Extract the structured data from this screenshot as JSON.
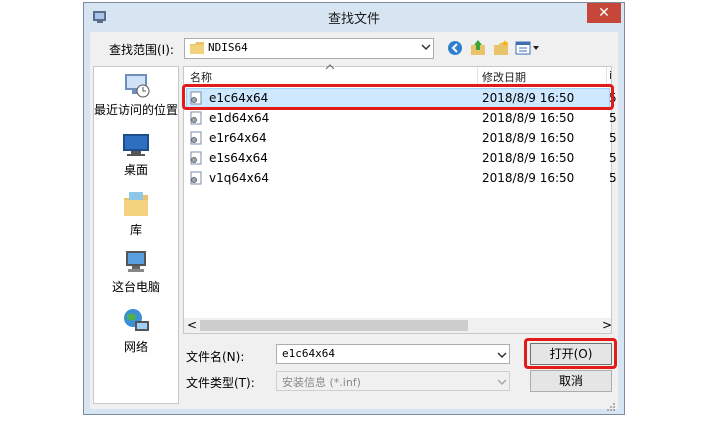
{
  "window": {
    "title": "查找文件",
    "close_glyph": "✕"
  },
  "lookin": {
    "label": "查找范围(I):",
    "value": "NDIS64"
  },
  "toolbar": {
    "icons": [
      "back-icon",
      "up-folder-icon",
      "new-folder-icon",
      "view-menu-icon"
    ]
  },
  "places": [
    {
      "label": "最近访问的位置",
      "icon": "recent-places-icon"
    },
    {
      "label": "桌面",
      "icon": "desktop-icon"
    },
    {
      "label": "库",
      "icon": "libraries-icon"
    },
    {
      "label": "这台电脑",
      "icon": "computer-icon"
    },
    {
      "label": "网络",
      "icon": "network-icon"
    }
  ],
  "columns": {
    "name": "名称",
    "date": "修改日期",
    "cut": "i"
  },
  "files": [
    {
      "name": "e1c64x64",
      "date": "2018/8/9 16:50",
      "cut": "5",
      "selected": true
    },
    {
      "name": "e1d64x64",
      "date": "2018/8/9 16:50",
      "cut": "5"
    },
    {
      "name": "e1r64x64",
      "date": "2018/8/9 16:50",
      "cut": "5"
    },
    {
      "name": "e1s64x64",
      "date": "2018/8/9 16:50",
      "cut": "5"
    },
    {
      "name": "v1q64x64",
      "date": "2018/8/9 16:50",
      "cut": "5"
    }
  ],
  "scroll": {
    "left": "<",
    "right": ">"
  },
  "filename": {
    "label": "文件名(N):",
    "value": "e1c64x64"
  },
  "filetype": {
    "label": "文件类型(T):",
    "value": "安装信息 (*.inf)"
  },
  "buttons": {
    "open": "打开(O)",
    "cancel": "取消"
  },
  "colors": {
    "highlight": "#e21a1a",
    "selection": "#cde8ff",
    "chrome": "#d7e4f2"
  }
}
